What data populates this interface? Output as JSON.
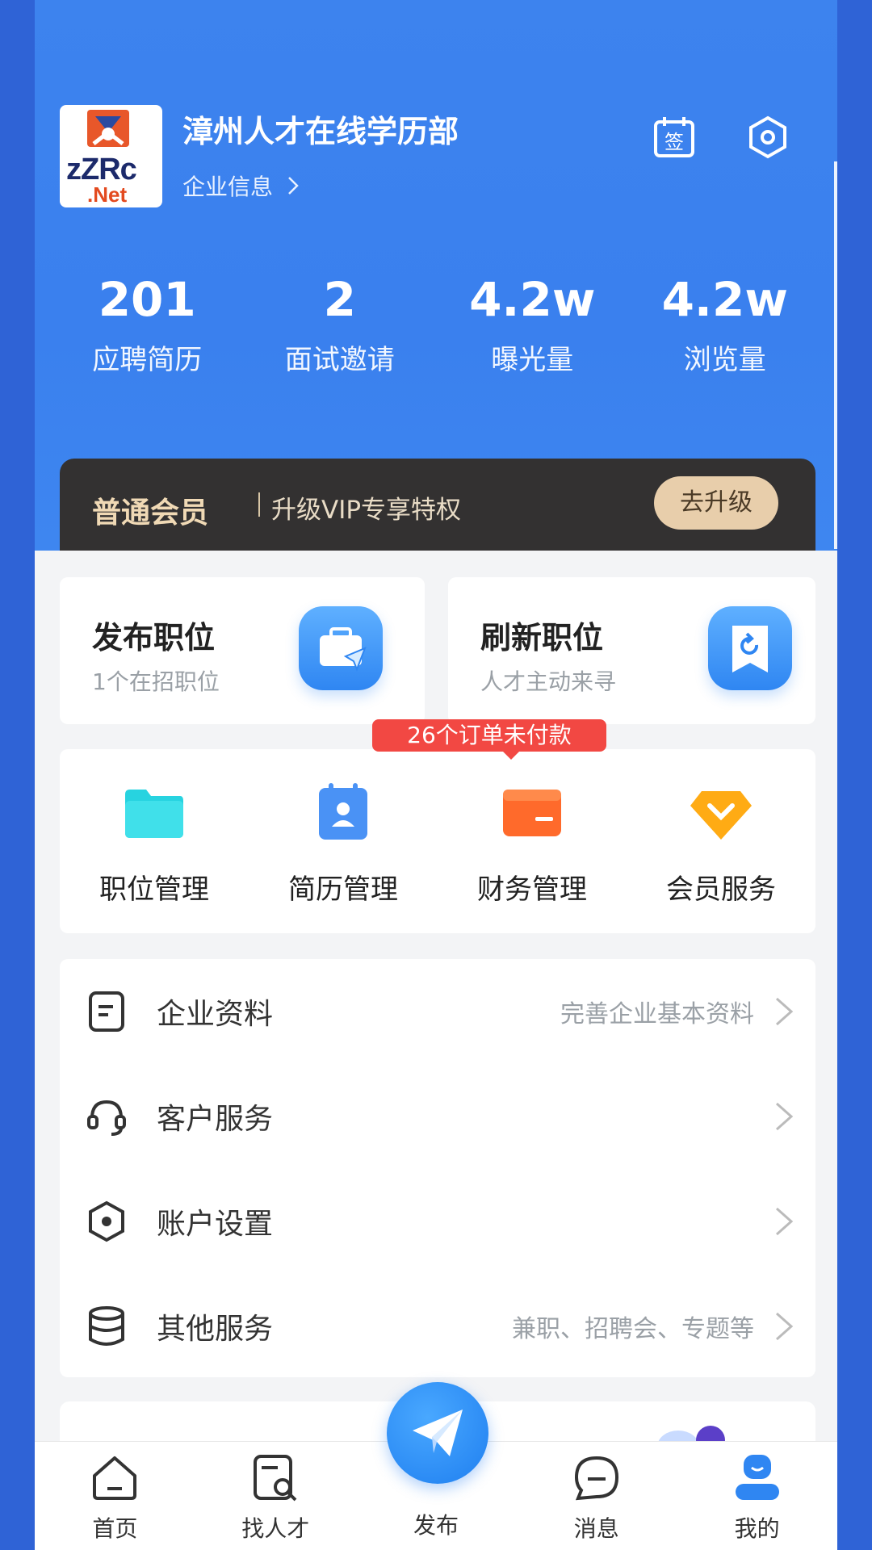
{
  "header": {
    "company_name": "漳州人才在线学历部",
    "company_info_link": "企业信息",
    "logo_text": {
      "zz": "zZRc",
      "net": ".Net"
    }
  },
  "stats": [
    {
      "value": "201",
      "label": "应聘简历"
    },
    {
      "value": "2",
      "label": "面试邀请"
    },
    {
      "value": "4.2w",
      "label": "曝光量"
    },
    {
      "value": "4.2w",
      "label": "浏览量"
    }
  ],
  "membership": {
    "tier": "普通会员",
    "promo": "升级VIP专享特权",
    "upgrade_button": "去升级"
  },
  "quick_actions": [
    {
      "title": "发布职位",
      "subtitle": "1个在招职位",
      "icon": "briefcase-send-icon"
    },
    {
      "title": "刷新职位",
      "subtitle": "人才主动来寻",
      "icon": "refresh-bookmark-icon"
    }
  ],
  "unpaid_badge": "26个订单未付款",
  "tools": [
    {
      "label": "职位管理",
      "icon": "folder-icon"
    },
    {
      "label": "简历管理",
      "icon": "resume-icon"
    },
    {
      "label": "财务管理",
      "icon": "wallet-icon"
    },
    {
      "label": "会员服务",
      "icon": "diamond-icon"
    }
  ],
  "menu": [
    {
      "label": "企业资料",
      "hint": "完善企业基本资料",
      "icon": "document-icon"
    },
    {
      "label": "客户服务",
      "hint": "",
      "icon": "headset-icon"
    },
    {
      "label": "账户设置",
      "hint": "",
      "icon": "settings-hex-icon"
    },
    {
      "label": "其他服务",
      "hint": "兼职、招聘会、专题等",
      "icon": "database-icon"
    }
  ],
  "tabbar": [
    {
      "label": "首页",
      "icon": "home-icon"
    },
    {
      "label": "找人才",
      "icon": "search-resume-icon"
    },
    {
      "label": "发布",
      "icon": "paper-plane-icon"
    },
    {
      "label": "消息",
      "icon": "message-icon"
    },
    {
      "label": "我的",
      "icon": "profile-icon"
    }
  ],
  "colors": {
    "primary": "#3a80ee",
    "badge": "#f24843",
    "vip_bg": "#333131",
    "vip_gold": "#e8ceab"
  }
}
